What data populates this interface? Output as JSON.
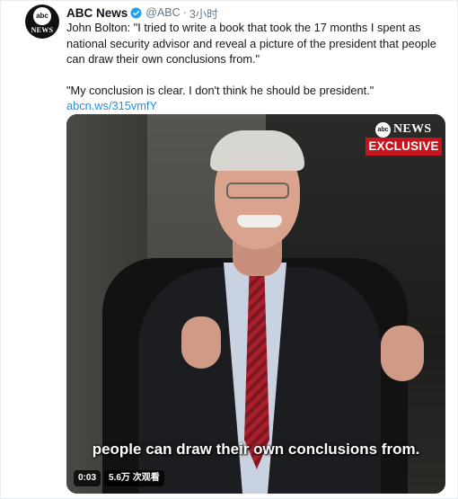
{
  "tweet": {
    "author_name": "ABC News",
    "handle": "@ABC",
    "separator": "·",
    "time": "3小时",
    "avatar_top": "abc",
    "avatar_bottom": "NEWS",
    "text_1": "John Bolton: \"I tried to write a book that took the 17 months I spent as national security advisor and reveal a picture of the president that people can draw their own conclusions from.\"",
    "text_2_prefix": "\"My conclusion is clear. I don't think he should be president.\" ",
    "link_text": "abcn.ws/315vmfY"
  },
  "media": {
    "logo_small": "abc",
    "logo_news": "NEWS",
    "badge": "EXCLUSIVE",
    "caption": "people can draw their own conclusions from.",
    "duration": "0:03",
    "views": "5.6万 次观看"
  },
  "colors": {
    "link": "#1b95e0",
    "verified": "#1da1f2",
    "exclusive": "#c8141e"
  }
}
